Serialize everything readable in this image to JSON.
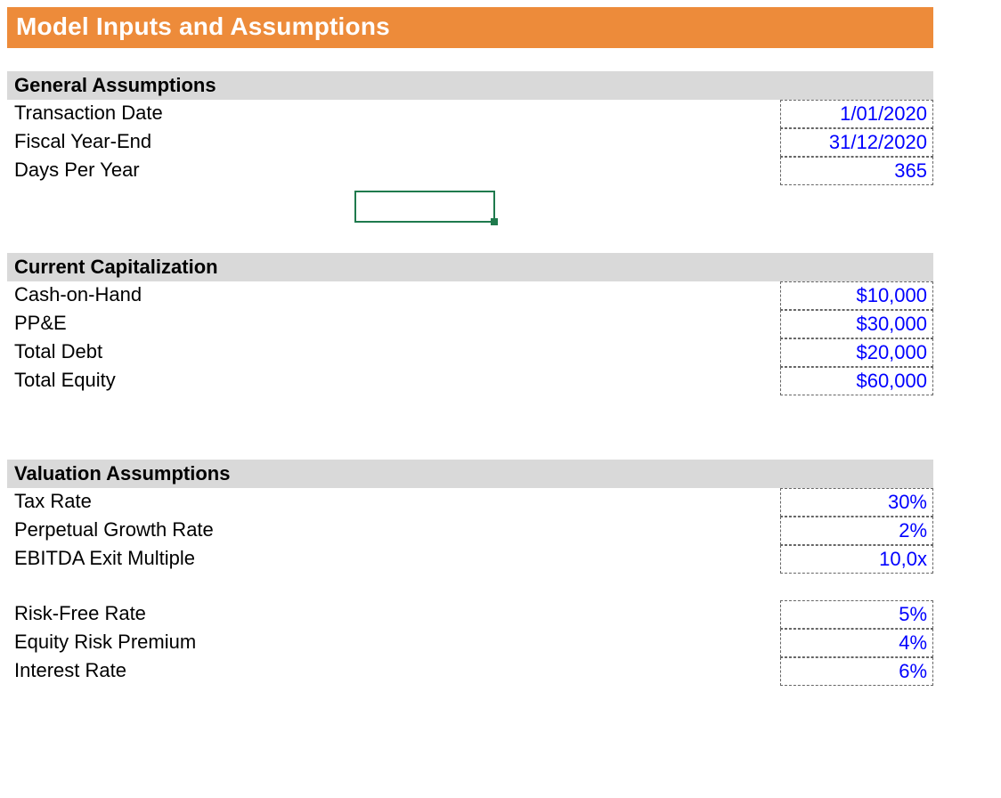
{
  "title": "Model Inputs and Assumptions",
  "sections": {
    "general": {
      "header": "General Assumptions",
      "transaction_date_label": "Transaction Date",
      "transaction_date_value": "1/01/2020",
      "fiscal_year_end_label": "Fiscal Year-End",
      "fiscal_year_end_value": "31/12/2020",
      "days_per_year_label": "Days Per Year",
      "days_per_year_value": "365"
    },
    "capitalization": {
      "header": "Current Capitalization",
      "cash_label": "Cash-on-Hand",
      "cash_value": "$10,000",
      "ppe_label": "PP&E",
      "ppe_value": "$30,000",
      "debt_label": "Total Debt",
      "debt_value": "$20,000",
      "equity_label": "Total Equity",
      "equity_value": "$60,000"
    },
    "valuation": {
      "header": "Valuation Assumptions",
      "tax_label": "Tax Rate",
      "tax_value": "30%",
      "growth_label": "Perpetual Growth Rate",
      "growth_value": "2%",
      "exit_label": "EBITDA Exit Multiple",
      "exit_value": "10,0x",
      "rfr_label": "Risk-Free Rate",
      "rfr_value": "5%",
      "erp_label": "Equity Risk Premium",
      "erp_value": "4%",
      "ir_label": "Interest Rate",
      "ir_value": "6%"
    }
  }
}
